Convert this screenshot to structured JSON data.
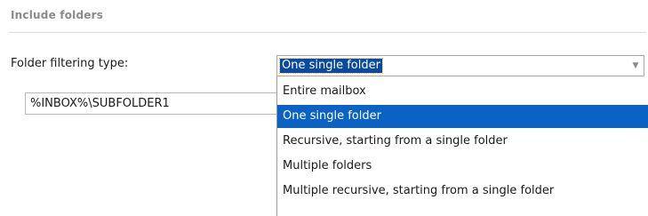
{
  "section": {
    "title": "Include folders"
  },
  "filter": {
    "label": "Folder filtering type:",
    "selected_value": "One single folder"
  },
  "path_input": {
    "value": "%INBOX%\\SUBFOLDER1"
  },
  "dropdown": {
    "items": [
      {
        "label": "Entire mailbox"
      },
      {
        "label": "One single folder",
        "selected": true
      },
      {
        "label": "Recursive, starting from a single folder"
      },
      {
        "label": "Multiple folders"
      },
      {
        "label": "Multiple recursive, starting from a single folder"
      }
    ]
  },
  "colors": {
    "highlight": "#0a63c4",
    "section_title": "#8a8a8a"
  },
  "icons": {
    "dropdown_arrow": "chevron-down-icon"
  }
}
